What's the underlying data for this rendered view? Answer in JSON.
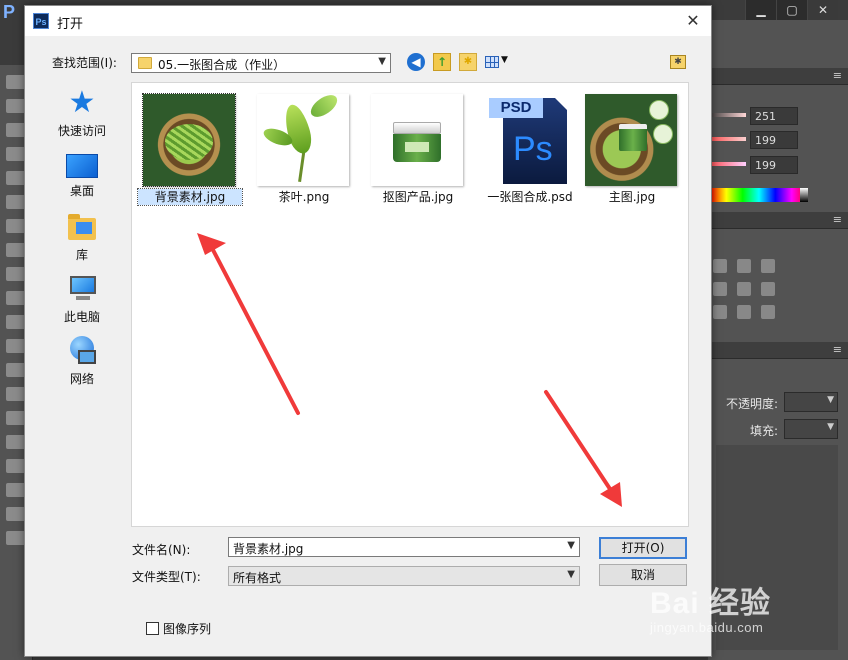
{
  "dialog": {
    "title": "打开",
    "app_icon_text": "Ps",
    "close_symbol": "✕"
  },
  "lookin": {
    "label": "查找范围(I):",
    "value": "05.一张图合成（作业）"
  },
  "places": [
    {
      "label": "快速访问"
    },
    {
      "label": "桌面"
    },
    {
      "label": "库"
    },
    {
      "label": "此电脑"
    },
    {
      "label": "网络"
    }
  ],
  "files": [
    {
      "name": "背景素材.jpg",
      "selected": true
    },
    {
      "name": "茶叶.png",
      "selected": false
    },
    {
      "name": "抠图产品.jpg",
      "selected": false
    },
    {
      "name": "一张图合成.psd",
      "selected": false
    },
    {
      "name": "主图.jpg",
      "selected": false
    }
  ],
  "psd_icon_band": "PSD",
  "psd_icon_mark": "Ps",
  "filename": {
    "label": "文件名(N):",
    "value": "背景素材.jpg"
  },
  "filetype": {
    "label": "文件类型(T):",
    "value": "所有格式"
  },
  "buttons": {
    "open": "打开(O)",
    "cancel": "取消"
  },
  "image_sequence_label": "图像序列",
  "photoshop": {
    "logo": "P",
    "color_values": [
      "251",
      "199",
      "199"
    ],
    "opacity_label": "不透明度:",
    "fill_label": "填充:"
  },
  "watermark": {
    "main": "Bai 经验",
    "sub": "jingyan.baidu.com"
  },
  "colors": {
    "selection_bg": "#cce4ff",
    "default_button_border": "#3c7fd6",
    "annotation_arrow": "#f03a3a"
  }
}
